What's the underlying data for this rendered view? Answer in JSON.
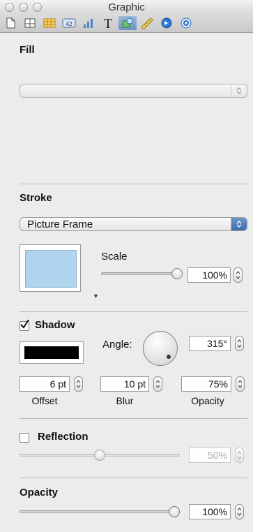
{
  "window": {
    "title": "Graphic"
  },
  "toolbar": {
    "buttons": [
      {
        "name": "document-inspector-icon"
      },
      {
        "name": "layout-inspector-icon"
      },
      {
        "name": "table-inspector-icon"
      },
      {
        "name": "format-inspector-icon",
        "glyph": "42"
      },
      {
        "name": "chart-inspector-icon"
      },
      {
        "name": "text-inspector-icon",
        "glyph": "T"
      },
      {
        "name": "graphic-inspector-icon",
        "active": true
      },
      {
        "name": "metrics-inspector-icon"
      },
      {
        "name": "link-inspector-icon"
      },
      {
        "name": "quicktime-inspector-icon"
      }
    ]
  },
  "fill": {
    "heading": "Fill",
    "popup_value": ""
  },
  "stroke": {
    "heading": "Stroke",
    "popup_value": "Picture Frame",
    "swatch_color": "#b0d4ee",
    "scale_label": "Scale",
    "scale_value": "100%",
    "scale_level": 1.0
  },
  "shadow": {
    "heading": "Shadow",
    "checked": true,
    "color": "#000000",
    "angle_label": "Angle:",
    "angle_value": "315°",
    "offset_value": "6 pt",
    "offset_label": "Offset",
    "blur_value": "10 pt",
    "blur_label": "Blur",
    "opacity_value": "75%",
    "opacity_label": "Opacity"
  },
  "reflection": {
    "heading": "Reflection",
    "checked": false,
    "value": "50%",
    "level": 0.5
  },
  "opacity": {
    "heading": "Opacity",
    "value": "100%",
    "level": 1.0
  }
}
